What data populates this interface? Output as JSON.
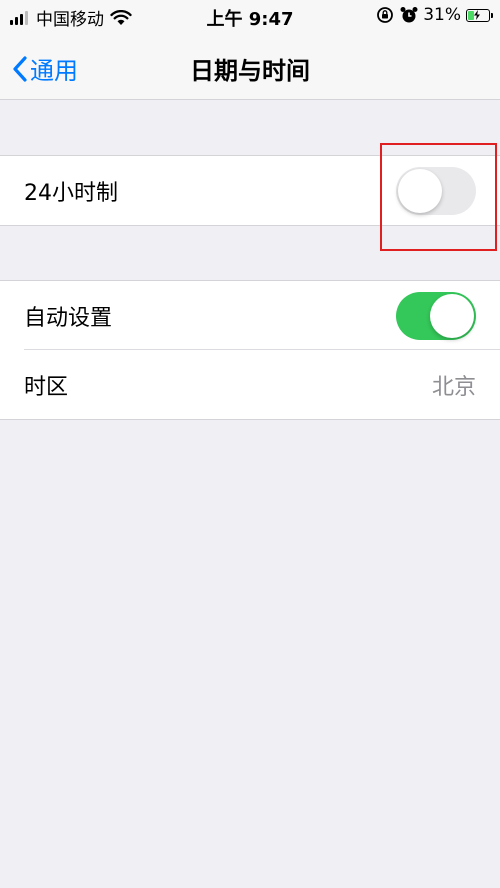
{
  "status_bar": {
    "carrier": "中国移动",
    "time": "上午 9:47",
    "battery_percent": "31%",
    "battery_level": 0.31,
    "signal_bars_active": 3,
    "icons": [
      "signal-icon",
      "wifi-icon",
      "orientation-lock-icon",
      "alarm-icon",
      "battery-charging-icon"
    ]
  },
  "nav": {
    "back_label": "通用",
    "title": "日期与时间"
  },
  "settings": {
    "hour24": {
      "label": "24小时制",
      "enabled": false
    },
    "auto_set": {
      "label": "自动设置",
      "enabled": true
    },
    "timezone": {
      "label": "时区",
      "value": "北京"
    }
  },
  "colors": {
    "ios_blue": "#007aff",
    "switch_on": "#34c759",
    "switch_off": "#e9e9eb",
    "highlight_box": "#e02020",
    "background": "#efeff4"
  }
}
